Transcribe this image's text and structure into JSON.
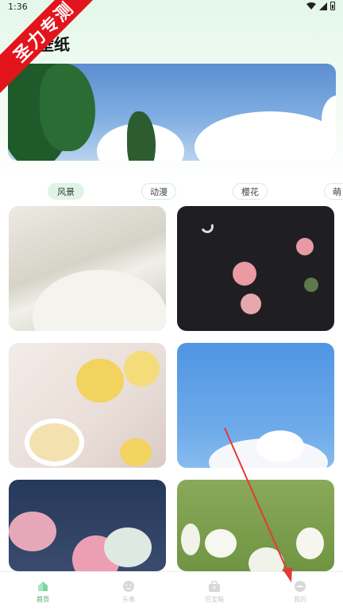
{
  "status_bar": {
    "time": "1:36"
  },
  "ribbon": {
    "text": "圣力专测"
  },
  "page": {
    "title": "壁纸"
  },
  "tabs": [
    {
      "label": "风景",
      "active": true
    },
    {
      "label": "动漫",
      "active": false
    },
    {
      "label": "樱花",
      "active": false
    },
    {
      "label": "萌",
      "active": false
    }
  ],
  "bottom_nav": [
    {
      "label": "首页",
      "icon": "home-icon",
      "active": true
    },
    {
      "label": "头像",
      "icon": "smile-icon",
      "active": false
    },
    {
      "label": "百宝箱",
      "icon": "toolbox-icon",
      "active": false
    },
    {
      "label": "我的",
      "icon": "profile-icon",
      "active": false
    }
  ],
  "colors": {
    "accent": "#46a36a",
    "ribbon": "#e3141b",
    "annotation": "#e53935"
  }
}
